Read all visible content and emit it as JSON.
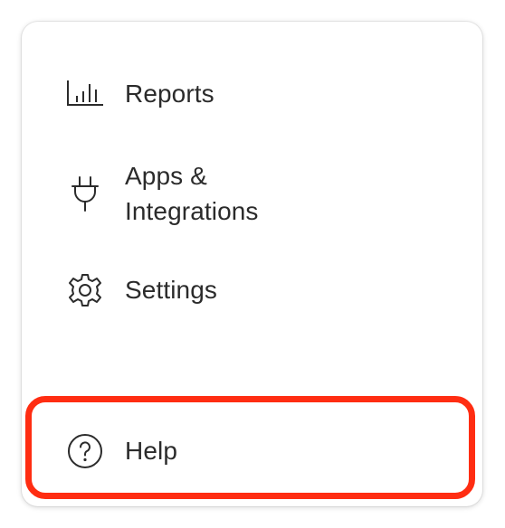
{
  "menu": {
    "items": [
      {
        "label": "Reports",
        "icon": "reports-chart-icon"
      },
      {
        "label_line1": "Apps &",
        "label_line2": "Integrations",
        "icon": "plug-icon"
      },
      {
        "label": "Settings",
        "icon": "gear-icon"
      }
    ],
    "help": {
      "label": "Help",
      "icon": "question-circle-icon"
    }
  },
  "colors": {
    "text": "#2b2b2b",
    "highlight": "#ff2d12",
    "background": "#ffffff"
  }
}
